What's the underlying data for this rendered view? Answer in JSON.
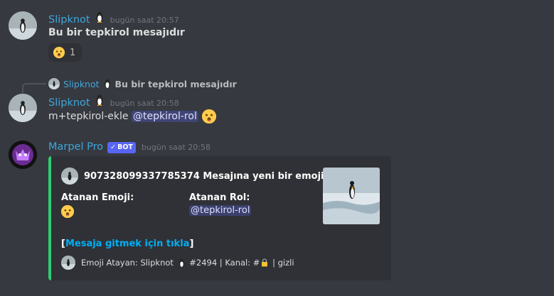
{
  "colors": {
    "background": "#36393f",
    "embed_bg": "#2f3136",
    "embed_accent": "#2ecc71",
    "slipknot_name": "#3ea6dd",
    "marpel_name": "#3ea6dd",
    "link": "#00aff4",
    "mention_bg": "rgba(88,101,242,.3)",
    "bot_tag": "#5865f2"
  },
  "messages": [
    {
      "author": "Slipknot",
      "author_icon": "penguin-icon",
      "timestamp": "bugün saat 20:57",
      "content": "Bu bir tepkirol mesajıdır",
      "reaction": {
        "emoji": "hushed-face-icon",
        "count": "1"
      }
    },
    {
      "reply": {
        "author": "Slipknot",
        "content": "Bu bir tepkirol mesajıdır"
      },
      "author": "Slipknot",
      "author_icon": "penguin-icon",
      "timestamp": "bugün saat 20:58",
      "content_prefix": "m+tepkirol-ekle ",
      "mention": "@tepkirol-rol",
      "trailing_emoji": "hushed-face-icon"
    },
    {
      "author": "Marpel Pro",
      "bot_label": "BOT",
      "bot_check": "✓",
      "timestamp": "bugün saat 20:58",
      "embed": {
        "author_text": "907328099337785374 Mesajına yeni bir emoji atandı",
        "fields": [
          {
            "name": "Atanan Emoji:",
            "value_emoji": "hushed-face-icon"
          },
          {
            "name": "Atanan Rol:",
            "value": "@tepkirol-rol"
          }
        ],
        "link_open": "[",
        "link_text": "Mesaja gitmek için tıkla",
        "link_close": "]",
        "footer_prefix": "Emoji Atayan: Slipknot ",
        "footer_mid": " #2494 | Kanal: #",
        "footer_suffix": " | gizli"
      }
    }
  ]
}
